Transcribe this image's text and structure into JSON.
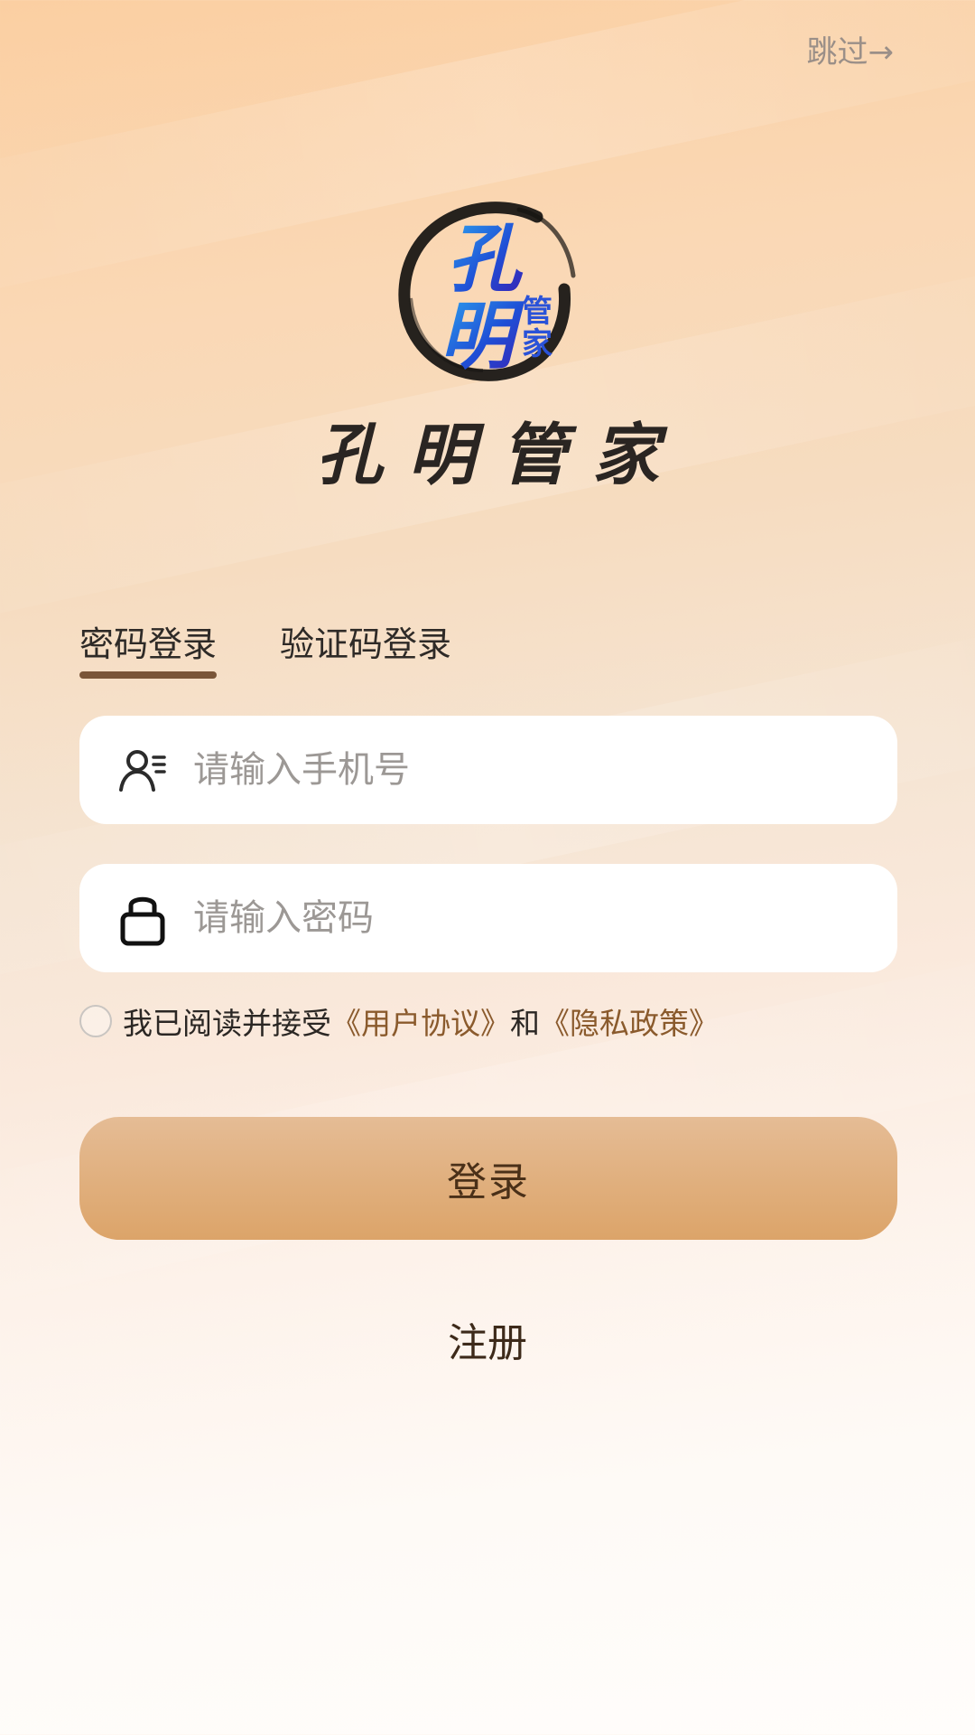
{
  "header": {
    "skip_label": "跳过→"
  },
  "brand": {
    "emblem_text_big": [
      "孔",
      "明"
    ],
    "emblem_text_small": [
      "管",
      "家"
    ],
    "title": "孔明管家"
  },
  "tabs": [
    {
      "label": "密码登录",
      "active": true
    },
    {
      "label": "验证码登录",
      "active": false
    }
  ],
  "form": {
    "phone_placeholder": "请输入手机号",
    "phone_icon": "user-list-icon",
    "password_placeholder": "请输入密码",
    "password_icon": "lock-icon"
  },
  "agreement": {
    "checked": false,
    "prefix": "我已阅读并接受",
    "user_agreement": "《用户协议》",
    "conjunction": "和",
    "privacy_policy": "《隐私政策》"
  },
  "actions": {
    "login_label": "登录",
    "register_label": "注册"
  },
  "colors": {
    "accent_link": "#8a5a2c",
    "button_top": "#e5bc95",
    "button_bottom": "#dca469",
    "tab_indicator": "#7a5538"
  }
}
